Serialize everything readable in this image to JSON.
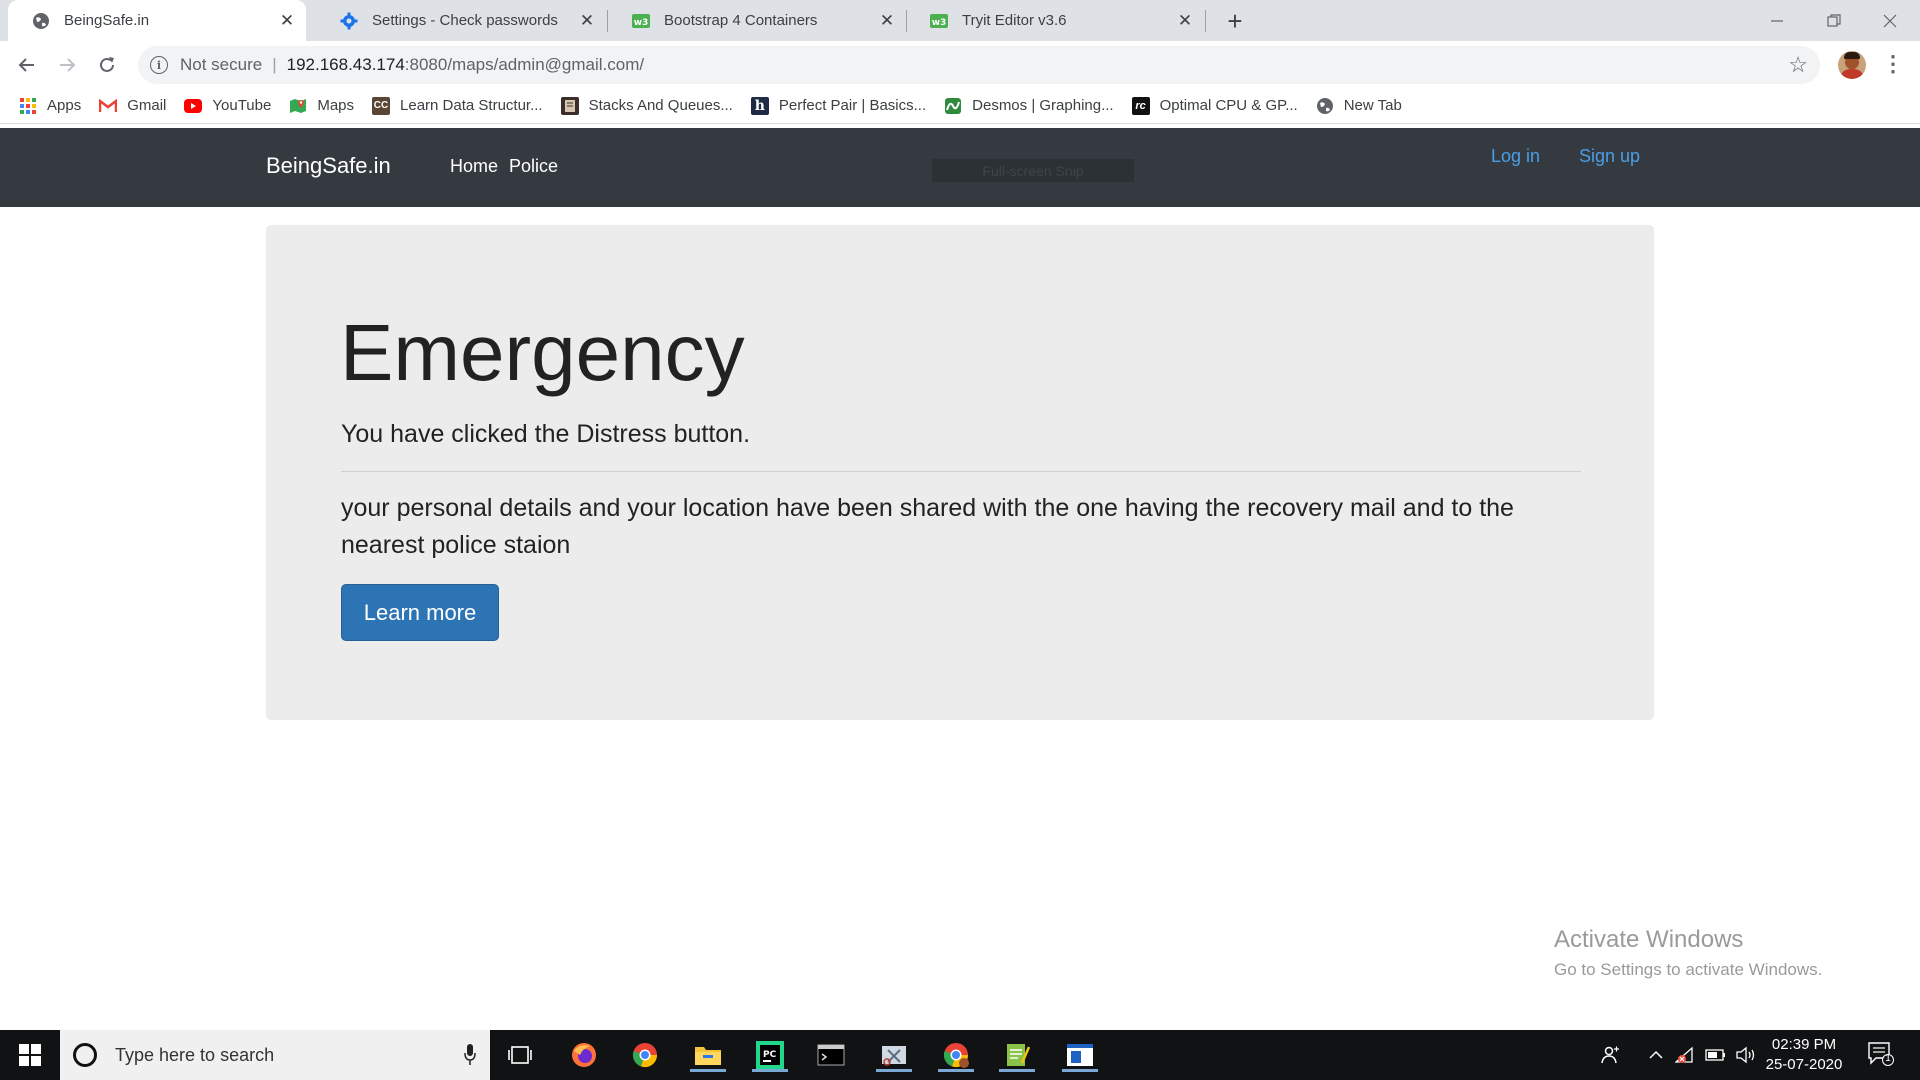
{
  "browser": {
    "tabs": [
      {
        "title": "BeingSafe.in",
        "active": true,
        "icon": "globe-icon"
      },
      {
        "title": "Settings - Check passwords",
        "active": false,
        "icon": "gear-icon"
      },
      {
        "title": "Bootstrap 4 Containers",
        "active": false,
        "icon": "w3schools-icon"
      },
      {
        "title": "Tryit Editor v3.6",
        "active": false,
        "icon": "w3schools-icon"
      }
    ],
    "new_tab_label": "+",
    "address": {
      "security_label": "Not secure",
      "url_host": "192.168.43.174",
      "url_path": ":8080/maps/admin@gmail.com/"
    },
    "bookmarks": [
      {
        "label": "Apps",
        "icon": "apps-grid-icon"
      },
      {
        "label": "Gmail",
        "icon": "gmail-icon"
      },
      {
        "label": "YouTube",
        "icon": "youtube-icon"
      },
      {
        "label": "Maps",
        "icon": "maps-icon"
      },
      {
        "label": "Learn Data Structur...",
        "icon": "cc-icon"
      },
      {
        "label": "Stacks And Queues...",
        "icon": "book-icon"
      },
      {
        "label": "Perfect Pair | Basics...",
        "icon": "hackerrank-icon"
      },
      {
        "label": "Desmos | Graphing...",
        "icon": "desmos-icon"
      },
      {
        "label": "Optimal CPU & GP...",
        "icon": "rc-icon"
      },
      {
        "label": "New Tab",
        "icon": "globe-icon"
      }
    ]
  },
  "site": {
    "brand": "BeingSafe.in",
    "nav": {
      "home": "Home",
      "police": "Police",
      "login": "Log in",
      "signup": "Sign up"
    },
    "snip_overlay": "Full-screen Snip",
    "jumbotron": {
      "heading": "Emergency",
      "lead": "You have clicked the Distress button.",
      "body": "your personal details and your location have been shared with the one having the recovery mail and to the nearest police staion",
      "button": "Learn more"
    }
  },
  "watermark": {
    "line1": "Activate Windows",
    "line2": "Go to Settings to activate Windows."
  },
  "taskbar": {
    "search_placeholder": "Type here to search",
    "time": "02:39 PM",
    "date": "25-07-2020",
    "notification_count": "1"
  },
  "colors": {
    "navbar_bg": "#343a40",
    "jumbotron_bg": "#ececec",
    "primary_button": "#2d74b4",
    "link": "#4a9ee8"
  }
}
